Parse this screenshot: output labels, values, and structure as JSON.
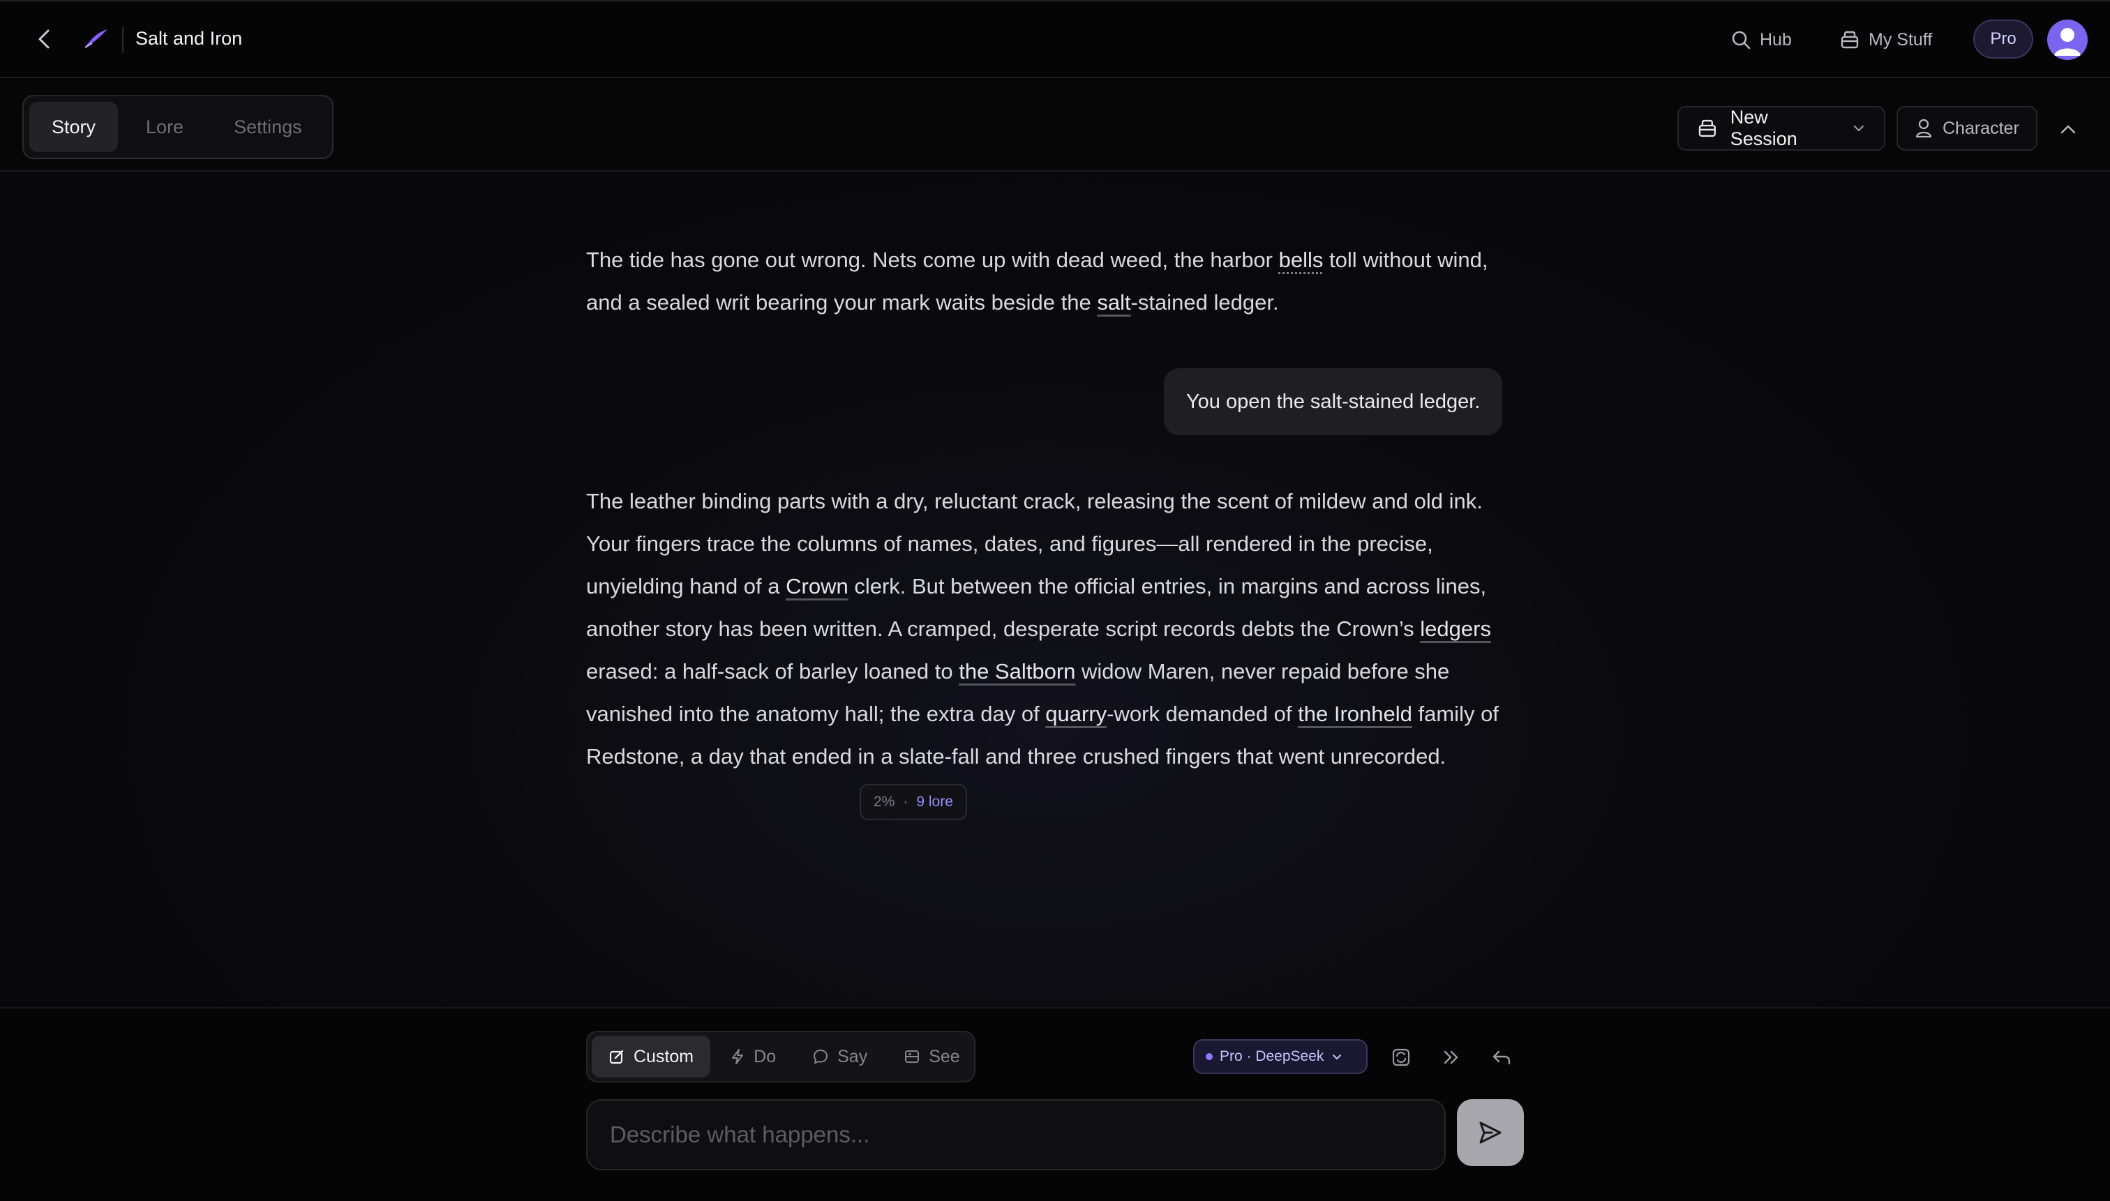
{
  "header": {
    "title": "Salt and Iron",
    "hub_label": "Hub",
    "mystuff_label": "My Stuff",
    "pro_label": "Pro"
  },
  "tabs": [
    {
      "label": "Story",
      "active": true
    },
    {
      "label": "Lore",
      "active": false
    },
    {
      "label": "Settings",
      "active": false
    }
  ],
  "session": {
    "label": "New Session",
    "character_label": "Character"
  },
  "story": {
    "p1_a": "The tide has gone out wrong. Nets come up with dead weed, the harbor ",
    "p1_bells": "bells",
    "p1_b": " toll without wind, and a sealed writ bearing your mark waits beside the ",
    "p1_salt": "salt",
    "p1_c": "-stained ledger.",
    "user_action": "You open the salt-stained ledger.",
    "p2_a": "The leather binding parts with a dry, reluctant crack, releasing the scent of mildew and old ink. Your fingers trace the columns of names, dates, and figures—all rendered in the precise, unyielding hand of a ",
    "p2_crown": "Crown",
    "p2_b": " clerk. But between the official entries, in margins and across lines, another story has been written. A cramped, desperate script records debts the Crown’s ",
    "p2_ledgers": "ledgers",
    "p2_c": " erased: a half-sack of barley loaned to ",
    "p2_saltborn": "the Saltborn",
    "p2_d": " widow Maren, never repaid before she vanished into the anatomy hall; the extra day of ",
    "p2_quarry": "quarry",
    "p2_e": "-work demanded of ",
    "p2_ironheld": "the Ironheld",
    "p2_f": " family of Redstone, a day that ended in a slate-fall and three crushed fingers that went unrecorded.",
    "meta_percent": "2%",
    "meta_sep": "·",
    "meta_lore": "9 lore"
  },
  "composer": {
    "modes": [
      {
        "label": "Custom",
        "icon": "edit-icon",
        "active": true
      },
      {
        "label": "Do",
        "icon": "bolt-icon",
        "active": false
      },
      {
        "label": "Say",
        "icon": "speech-bubble-icon",
        "active": false
      },
      {
        "label": "See",
        "icon": "image-icon",
        "active": false
      }
    ],
    "model_label": "Pro · DeepSeek",
    "placeholder": "Describe what happens..."
  },
  "colors": {
    "accent": "#8b7cff",
    "avatar": "#7b64f0",
    "background": "#0a0a0c"
  }
}
